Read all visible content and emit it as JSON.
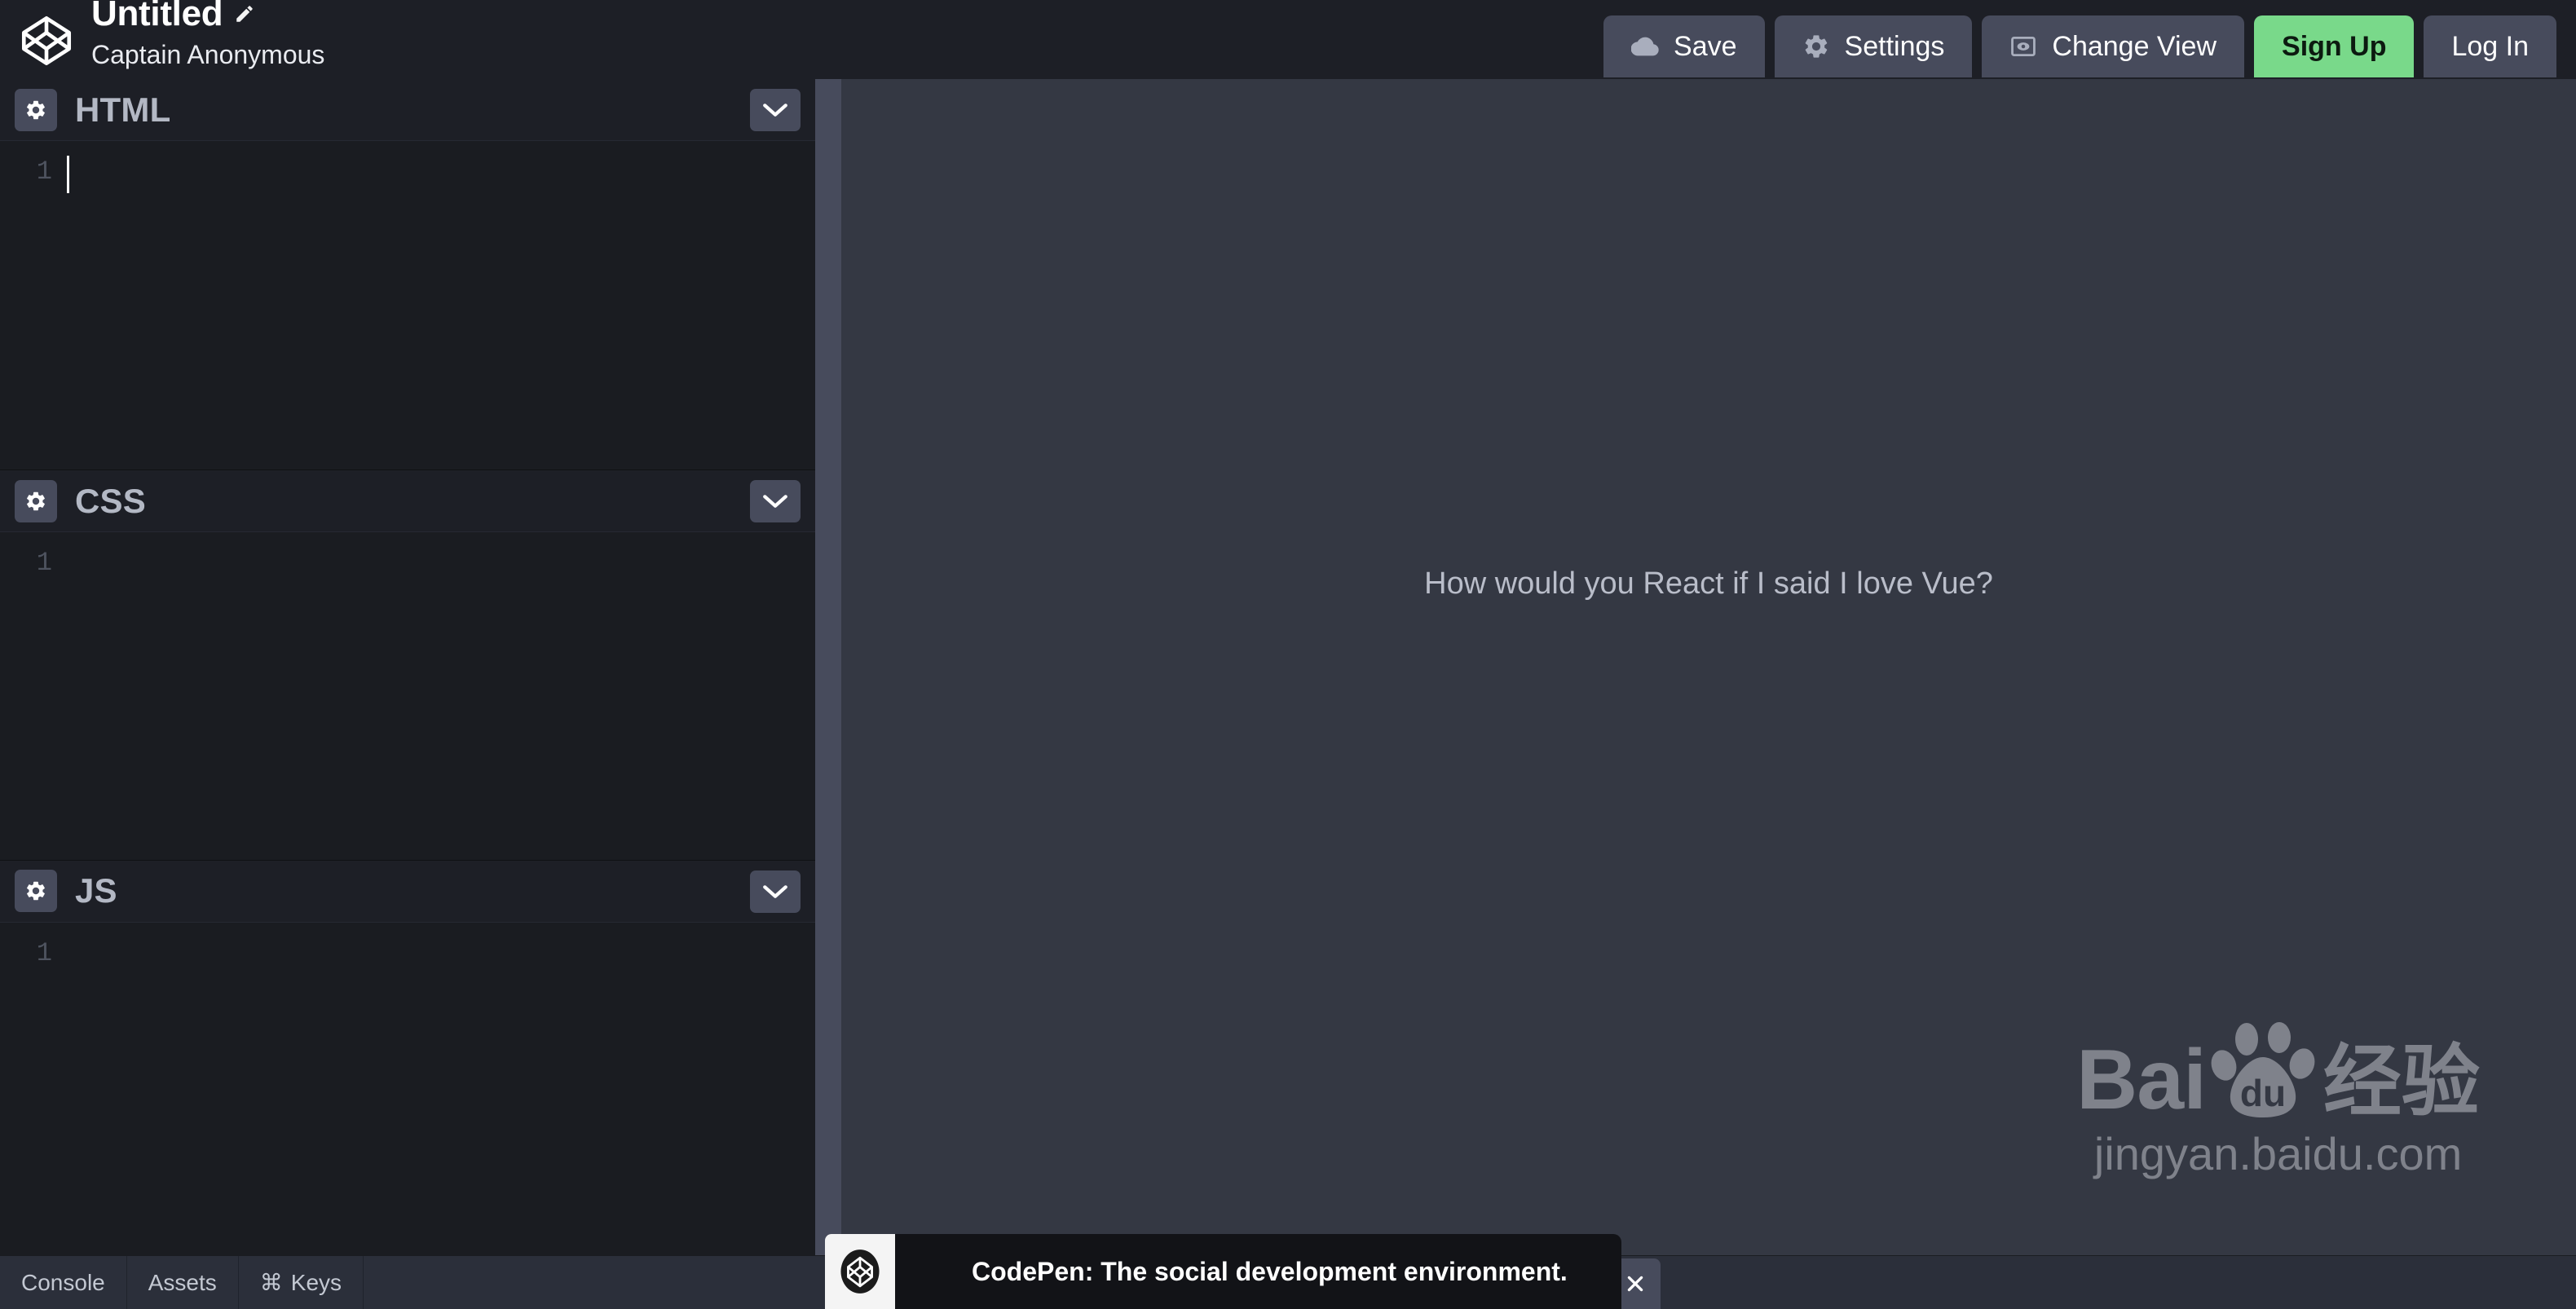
{
  "header": {
    "logo_icon": "codepen-logo-icon",
    "pen_title": "Untitled",
    "edit_icon": "pencil-edit-icon",
    "author": "Captain Anonymous",
    "actions": [
      {
        "label": "Save",
        "icon": "cloud-icon",
        "style": "default"
      },
      {
        "label": "Settings",
        "icon": "gear-icon",
        "style": "default"
      },
      {
        "label": "Change View",
        "icon": "eye-in-box-icon",
        "style": "default"
      },
      {
        "label": "Sign Up",
        "icon": "",
        "style": "primary"
      },
      {
        "label": "Log In",
        "icon": "",
        "style": "default"
      }
    ]
  },
  "editors": [
    {
      "title": "HTML",
      "gear_icon": "gear-icon",
      "collapse_icon": "chevron-down-icon",
      "line_number": "1",
      "code": "",
      "has_caret": true
    },
    {
      "title": "CSS",
      "gear_icon": "gear-icon",
      "collapse_icon": "chevron-down-icon",
      "line_number": "1",
      "code": "",
      "has_caret": false
    },
    {
      "title": "JS",
      "gear_icon": "gear-icon",
      "collapse_icon": "chevron-down-icon",
      "line_number": "1",
      "code": "",
      "has_caret": false
    }
  ],
  "preview": {
    "text": "How would you React if I said I love Vue?",
    "watermark": {
      "brand_left": "Bai",
      "brand_right": "du",
      "paw_icon": "baidu-paw-icon",
      "suffix_cn": "经验",
      "url": "jingyan.baidu.com"
    }
  },
  "bottombar": {
    "items": [
      {
        "label": "Console",
        "icon": ""
      },
      {
        "label": "Assets",
        "icon": ""
      },
      {
        "label": "Keys",
        "icon": "⌘"
      }
    ]
  },
  "toast": {
    "logo_icon": "codepen-logo-icon",
    "message": "CodePen: The social development environment.",
    "close_icon": "close-icon"
  },
  "colors": {
    "topbar_bg": "#1d1f26",
    "editor_bg": "#1a1c21",
    "pane_header_bg": "#1d1f26",
    "button_bg": "#474b5c",
    "accent_signup": "#79d98a",
    "preview_bg": "#343843",
    "bottombar_bg": "#2b2f3a",
    "toast_bg": "#121317",
    "text_muted": "#b3b8c4"
  }
}
